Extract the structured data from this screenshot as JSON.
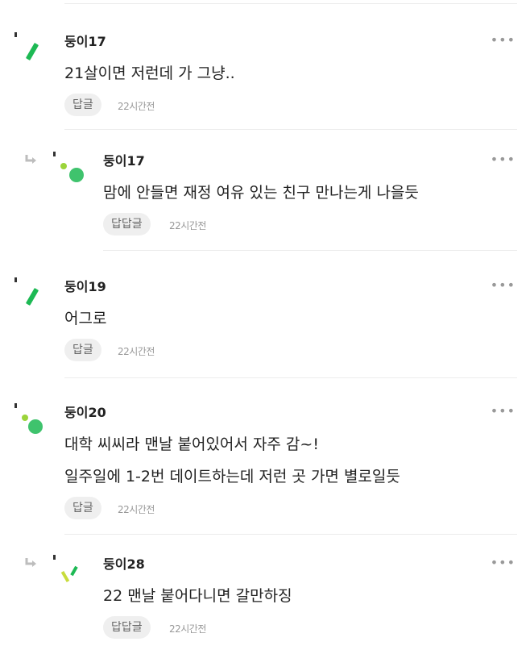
{
  "comments": [
    {
      "nickname": "둥이17",
      "lines": [
        "21살이면 저런데 가 그냥.."
      ],
      "reply_label": "답글",
      "time": "22시간전",
      "more": "•••",
      "avatar": "slash-avatar"
    },
    {
      "nickname": "둥이17",
      "lines": [
        "맘에 안들면 재정 여유 있는 친구 만나는게 나을듯"
      ],
      "reply_label": "답답글",
      "time": "22시간전",
      "more": "•••",
      "avatar": "dots-avatar"
    },
    {
      "nickname": "둥이19",
      "lines": [
        "어그로"
      ],
      "reply_label": "답글",
      "time": "22시간전",
      "more": "•••",
      "avatar": "slash-avatar"
    },
    {
      "nickname": "둥이20",
      "lines": [
        "대학 씨씨라 맨날 붙어있어서 자주 감~!",
        "일주일에 1-2번 데이트하는데 저런 곳 가면 별로일듯"
      ],
      "reply_label": "답글",
      "time": "22시간전",
      "more": "•••",
      "avatar": "dots-avatar"
    },
    {
      "nickname": "둥이28",
      "lines": [
        "22 맨날 붙어다니면 갈만하징"
      ],
      "reply_label": "답답글",
      "time": "22시간전",
      "more": "•••",
      "avatar": "check-avatar"
    }
  ],
  "colors": {
    "green": "#1db954",
    "light_green": "#9bd43a",
    "yellow_green": "#c8dc3c"
  }
}
